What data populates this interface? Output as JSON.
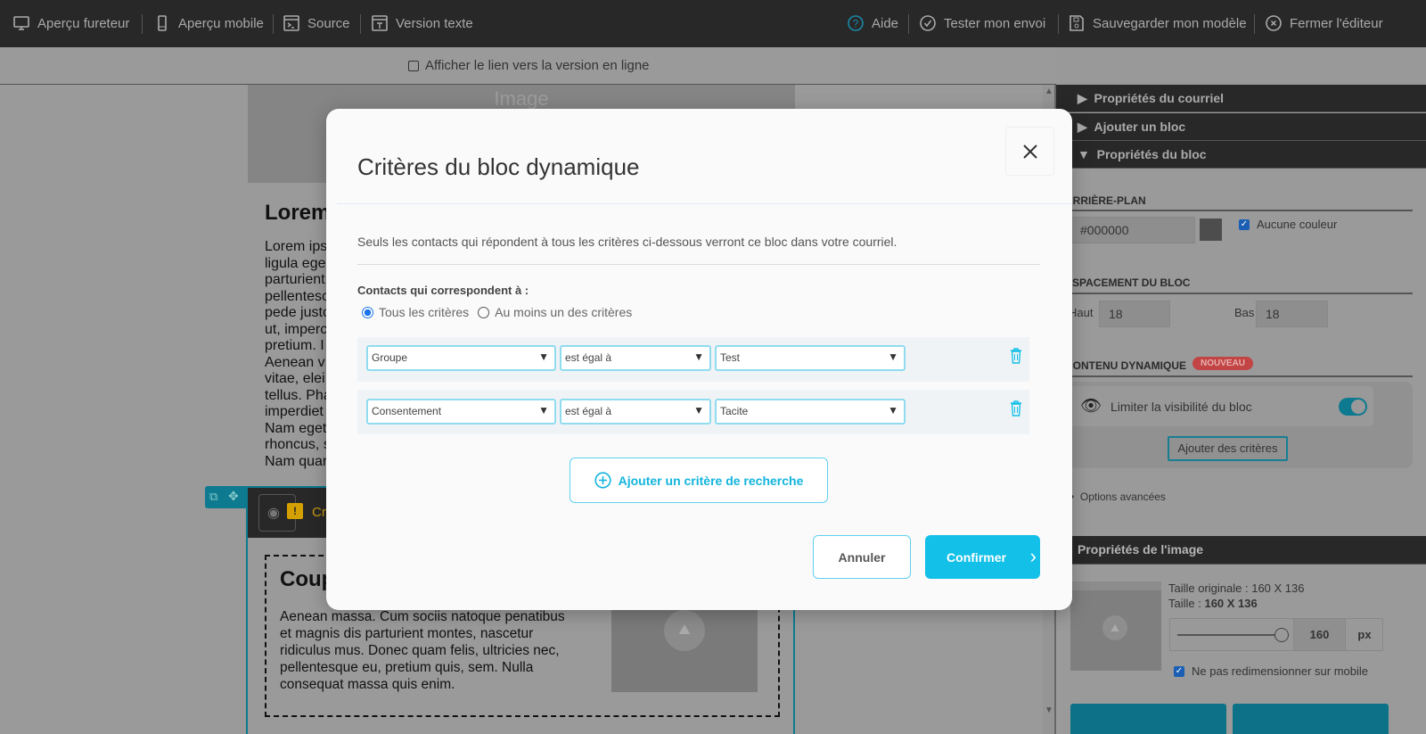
{
  "toolbar": {
    "left": [
      {
        "label": "Aperçu fureteur",
        "icon": "monitor-icon"
      },
      {
        "label": "Aperçu mobile",
        "icon": "mobile-icon"
      },
      {
        "label": "Source",
        "icon": "terminal-icon"
      },
      {
        "label": "Version texte",
        "icon": "text-version-icon"
      }
    ],
    "right": [
      {
        "label": "Aide",
        "icon": "help-icon"
      },
      {
        "label": "Tester mon envoi",
        "icon": "check-circle-icon"
      },
      {
        "label": "Sauvegarder mon modèle",
        "icon": "save-icon"
      },
      {
        "label": "Fermer l'éditeur",
        "icon": "close-circle-icon"
      }
    ]
  },
  "subbar": {
    "online_link_label": "Afficher le lien vers la version en ligne",
    "online_link_checked": false
  },
  "email": {
    "image_placeholder": "Image",
    "heading": "Lorem",
    "body_lines": [
      "Lorem ips",
      "ligula ege",
      "parturient",
      "pellentesc",
      "pede justo",
      "ut, imperc",
      "pretium. I",
      "Aenean v",
      "vitae, elei",
      "tellus. Pha",
      "imperdiet",
      "Nam eget",
      "rhoncus, s",
      "Nam quar"
    ],
    "dynamic_block_label": "Cri",
    "coupon_heading": "Coup",
    "coupon_text": [
      "Aenean massa. Cum sociis natoque penatibus",
      "et magnis dis parturient montes, nascetur",
      "ridiculus mus. Donec quam felis, ultricies nec,",
      "pellentesque eu, pretium quis, sem. Nulla",
      "consequat massa quis enim."
    ]
  },
  "panel": {
    "accordions": [
      "Propriétés du courriel",
      "Ajouter un bloc",
      "Propriétés du bloc"
    ],
    "background_title": "ARRIÈRE-PLAN",
    "background_color": "#000000",
    "no_color_label": "Aucune couleur",
    "no_color_checked": true,
    "spacing_title": "ESPACEMENT DU BLOC",
    "top_label": "Haut",
    "top_value": "18",
    "bottom_label": "Bas",
    "bottom_value": "18",
    "dynamic_title": "CONTENU DYNAMIQUE",
    "new_badge": "NOUVEAU",
    "limit_visibility_label": "Limiter la visibilité du bloc",
    "limit_visibility_on": true,
    "add_criteria_button": "Ajouter des critères",
    "advanced_options": "Options avancées",
    "image_props_title": "Propriétés de l'image",
    "original_size_label": "Taille originale : 160 X 136",
    "size_label": "Taille : ",
    "size_value": "160 X 136",
    "width_value": "160",
    "width_unit": "px",
    "slider_percent": 100,
    "no_resize_mobile_label": "Ne pas redimensionner sur mobile",
    "no_resize_mobile_checked": true
  },
  "modal": {
    "title": "Critères du bloc dynamique",
    "description": "Seuls les contacts qui répondent à tous les critères ci-dessous verront ce bloc dans votre courriel.",
    "match_label": "Contacts qui correspondent à :",
    "match_options": [
      "Tous les critères",
      "Au moins un des critères"
    ],
    "match_selected": "Tous les critères",
    "criteria": [
      {
        "field": "Groupe",
        "operator": "est égal à",
        "value": "Test"
      },
      {
        "field": "Consentement",
        "operator": "est égal à",
        "value": "Tacite"
      }
    ],
    "add_criterion_button": "Ajouter un critère de recherche",
    "cancel_button": "Annuler",
    "confirm_button": "Confirmer",
    "accent_color": "#12c0e8"
  }
}
